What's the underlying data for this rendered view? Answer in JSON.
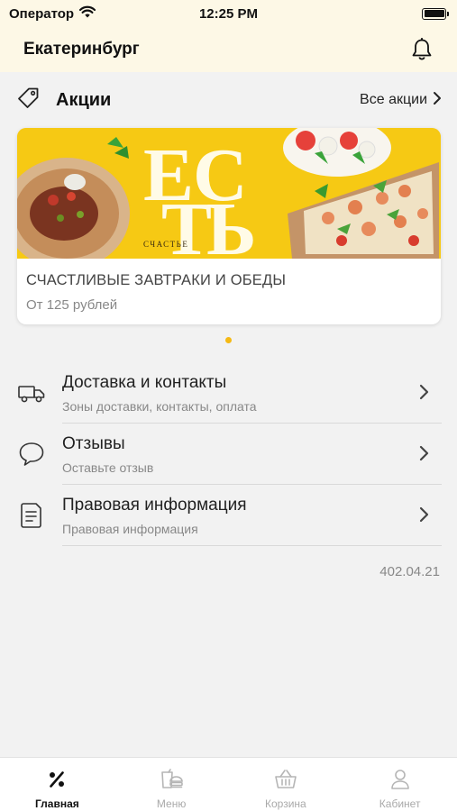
{
  "status_bar": {
    "carrier": "Оператор",
    "time": "12:25 PM",
    "wifi_icon": "wifi-icon",
    "battery_icon": "battery-icon"
  },
  "header": {
    "city": "Екатеринбург",
    "notification_icon": "bell-icon",
    "background_color": "#fdf8e6"
  },
  "promotions": {
    "icon": "tag-icon",
    "title": "Акции",
    "all_link": "Все акции",
    "card": {
      "banner_text": "СЧАСТЬЕ",
      "title": "СЧАСТЛИВЫЕ ЗАВТРАКИ И ОБЕДЫ",
      "subtitle": "От 125 рублей",
      "banner_color": "#f6c914"
    },
    "active_dot_color": "#f5b914"
  },
  "menu": [
    {
      "icon": "truck-icon",
      "title": "Доставка и контакты",
      "subtitle": "Зоны доставки, контакты, оплата"
    },
    {
      "icon": "chat-bubble-icon",
      "title": "Отзывы",
      "subtitle": "Оставьте отзыв"
    },
    {
      "icon": "document-icon",
      "title": "Правовая информация",
      "subtitle": "Правовая информация"
    }
  ],
  "version": "402.04.21",
  "tabbar": [
    {
      "label": "Главная",
      "icon": "percent-icon",
      "active": true
    },
    {
      "label": "Меню",
      "icon": "food-menu-icon",
      "active": false
    },
    {
      "label": "Корзина",
      "icon": "basket-icon",
      "active": false
    },
    {
      "label": "Кабинет",
      "icon": "user-icon",
      "active": false
    }
  ]
}
